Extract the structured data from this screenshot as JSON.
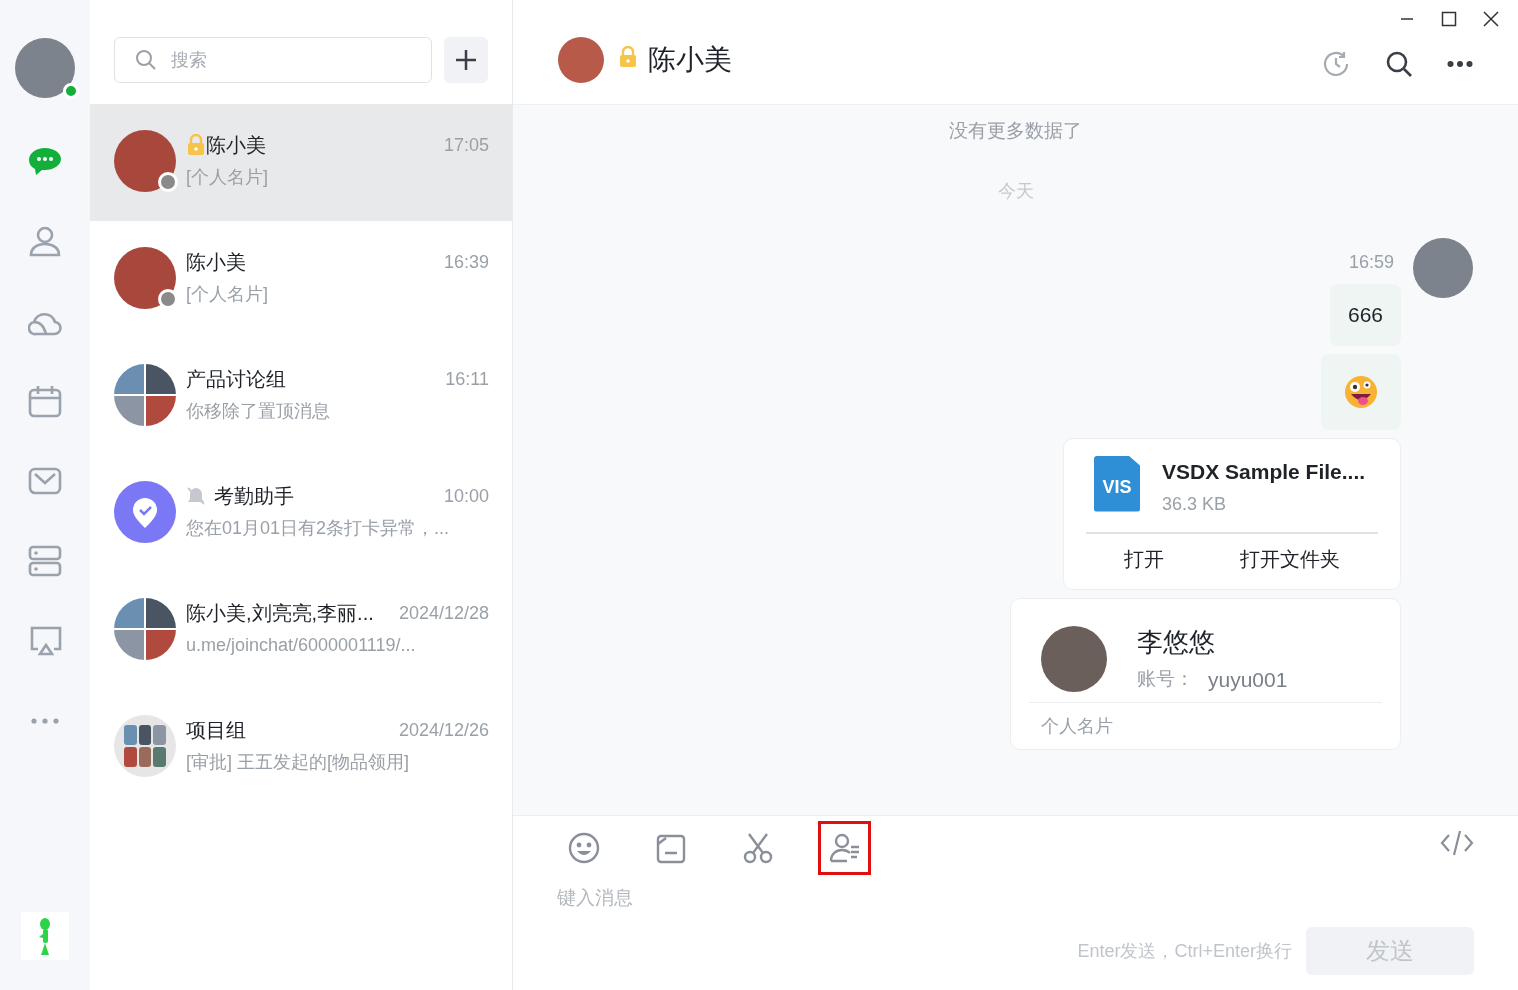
{
  "rail": {
    "user": {
      "color": "#12b03a"
    },
    "items": [
      {
        "kind": "chat",
        "selected": true
      },
      {
        "kind": "contacts",
        "selected": false
      },
      {
        "kind": "cloud",
        "selected": false
      },
      {
        "kind": "calendar",
        "selected": false
      },
      {
        "kind": "mail",
        "selected": false
      },
      {
        "kind": "storage",
        "selected": false
      },
      {
        "kind": "screen",
        "selected": false
      },
      {
        "kind": "more",
        "selected": false
      }
    ]
  },
  "search": {
    "placeholder": "搜索"
  },
  "chats": [
    {
      "kind": "photo",
      "color": "#8a8a8a",
      "locked": true,
      "muted": false,
      "name": "陈小美",
      "time": "17:05",
      "preview": "[个人名片]",
      "selected": true
    },
    {
      "kind": "photo",
      "color": "#8a8a8a",
      "locked": false,
      "muted": false,
      "name": "陈小美",
      "time": "16:39",
      "preview": "[个人名片]",
      "selected": false
    },
    {
      "kind": "group4",
      "locked": false,
      "muted": false,
      "name": "产品讨论组",
      "time": "16:11",
      "preview": "你移除了置顶消息",
      "selected": false
    },
    {
      "kind": "bot",
      "locked": false,
      "muted": true,
      "name": "考勤助手",
      "time": "10:00",
      "preview": "您在01月01日有2条打卡异常，...",
      "selected": false
    },
    {
      "kind": "group4",
      "locked": false,
      "muted": false,
      "name": "陈小美,刘亮亮,李丽...",
      "time": "2024/12/28",
      "preview": "u.me/joinchat/6000001119/...",
      "selected": false
    },
    {
      "kind": "group6",
      "locked": false,
      "muted": false,
      "name": "项目组",
      "time": "2024/12/26",
      "preview": "[审批] 王五发起的[物品领用]",
      "selected": false
    }
  ],
  "header": {
    "locked": true,
    "name": "陈小美"
  },
  "messages": [
    {
      "kind": "system",
      "text": "没有更多数据了"
    },
    {
      "kind": "date",
      "text": "今天"
    },
    {
      "kind": "time",
      "text": "16:59"
    },
    {
      "kind": "text",
      "text": "666"
    },
    {
      "kind": "emoji"
    },
    {
      "kind": "file",
      "badge": "VIS",
      "name": "VSDX Sample File....",
      "size": "36.3 KB",
      "actions": [
        "打开",
        "打开文件夹"
      ]
    },
    {
      "kind": "contact",
      "name": "李悠悠",
      "account_label": "账号：",
      "account": "yuyu001",
      "footer": "个人名片"
    }
  ],
  "toolbar": [
    {
      "kind": "emoji",
      "selected": false
    },
    {
      "kind": "folder",
      "selected": false
    },
    {
      "kind": "scissors",
      "selected": false
    },
    {
      "kind": "contact",
      "selected": true
    }
  ],
  "composer": {
    "placeholder": "键入消息",
    "hint": "Enter发送，Ctrl+Enter换行",
    "send": "发送",
    "send_disabled": true
  }
}
